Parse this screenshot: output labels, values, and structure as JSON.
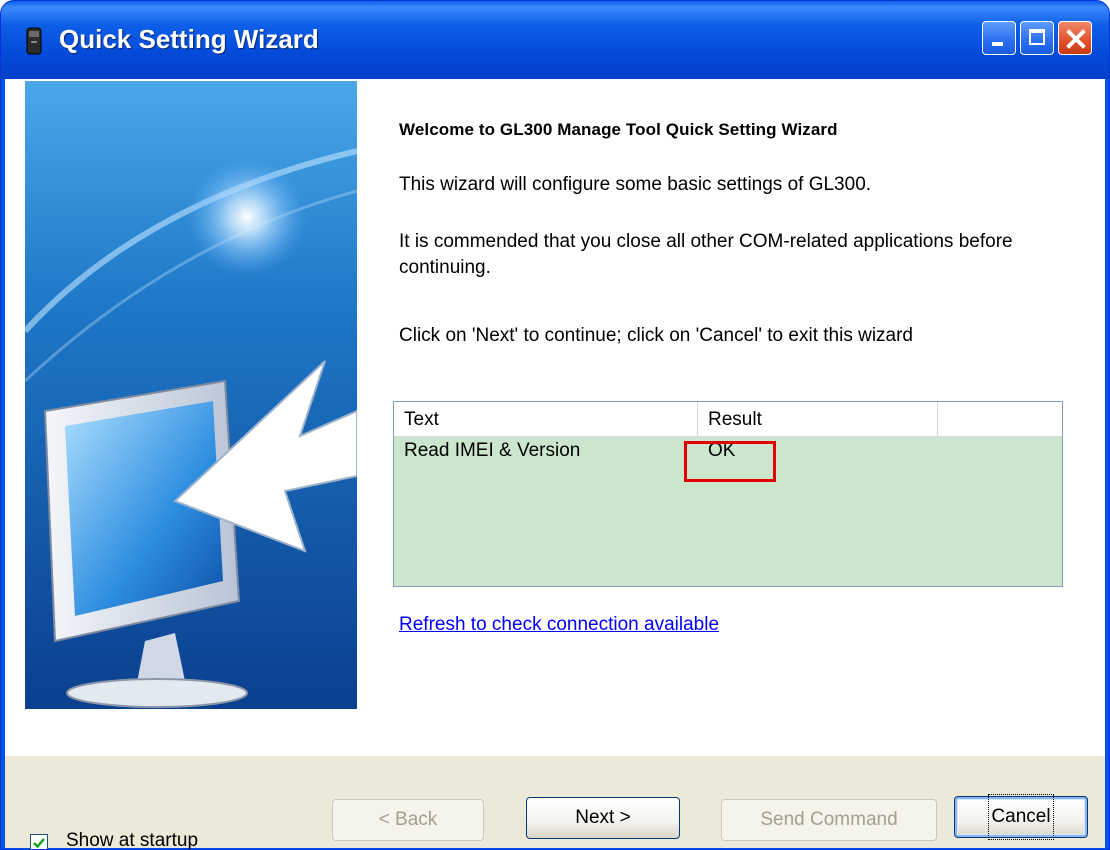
{
  "window": {
    "title": "Quick Setting Wizard"
  },
  "controls": {
    "minimize": "minimize-icon",
    "maximize": "maximize-icon",
    "close": "close-icon"
  },
  "content": {
    "welcome": "Welcome to GL300 Manage Tool  Quick Setting Wizard",
    "paragraph1": "This wizard will configure some basic settings of GL300.",
    "paragraph2": "It is commended that you close all other COM-related applications before continuing.",
    "paragraph3": "Click on 'Next' to continue; click on 'Cancel' to exit this wizard"
  },
  "list": {
    "columns": [
      "Text",
      "Result",
      ""
    ],
    "rows": [
      {
        "text": "Read IMEI & Version",
        "result": "OK"
      }
    ]
  },
  "refresh_link": "Refresh to check connection available",
  "footer": {
    "show_at_startup": {
      "label": "Show at startup",
      "checked": true
    },
    "back": "< Back",
    "next": "Next >",
    "send_command": "Send Command",
    "cancel": "Cancel"
  },
  "colors": {
    "title_bar": "#0054e3",
    "list_bg": "#cbe6cc",
    "highlight": "#e00000",
    "link": "#0000ff"
  }
}
